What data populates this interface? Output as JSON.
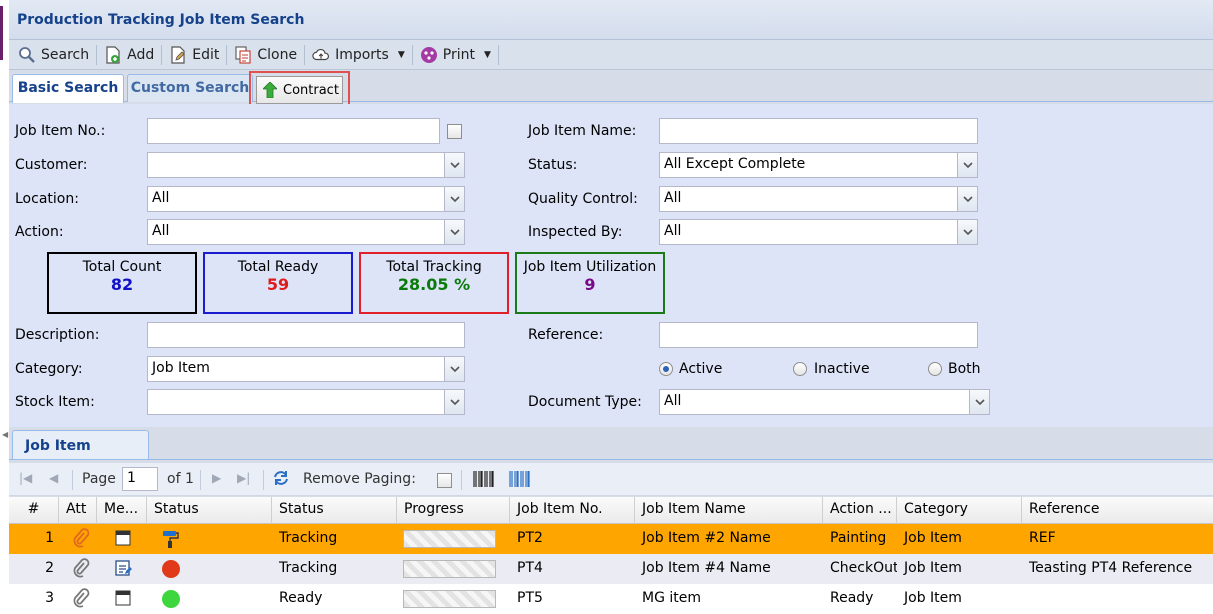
{
  "window": {
    "title": "Production Tracking Job Item Search"
  },
  "toolbar": {
    "search": "Search",
    "add": "Add",
    "edit": "Edit",
    "clone": "Clone",
    "imports": "Imports",
    "print": "Print"
  },
  "tabs": {
    "basic_search": "Basic Search",
    "custom_search": "Custom Search",
    "contract": "Contract"
  },
  "form": {
    "job_item_no_label": "Job Item No.:",
    "job_item_name_label": "Job Item Name:",
    "customer_label": "Customer:",
    "status_label": "Status:",
    "status_value": "All Except Complete",
    "location_label": "Location:",
    "location_value": "All",
    "quality_control_label": "Quality Control:",
    "quality_control_value": "All",
    "action_label": "Action:",
    "action_value": "All",
    "inspected_by_label": "Inspected By:",
    "inspected_by_value": "All",
    "description_label": "Description:",
    "reference_label": "Reference:",
    "category_label": "Category:",
    "category_value": "Job Item",
    "stock_item_label": "Stock Item:",
    "document_type_label": "Document Type:",
    "document_type_value": "All",
    "radio_active": "Active",
    "radio_inactive": "Inactive",
    "radio_both": "Both",
    "selected_radio": "Active"
  },
  "stats": {
    "total_count": {
      "label": "Total Count",
      "value": "82",
      "color": "#1010c8",
      "border": "#000000"
    },
    "total_ready": {
      "label": "Total Ready",
      "value": "59",
      "color": "#e01b1b",
      "border": "#1a1ad0"
    },
    "total_tracking": {
      "label": "Total Tracking",
      "value": "28.05 %",
      "color": "#0a7a0a",
      "border": "#e0202a"
    },
    "job_item_utilization": {
      "label": "Job Item Utilization",
      "value": "9",
      "color": "#7a0a8a",
      "border": "#1a7a1a"
    }
  },
  "grid": {
    "tab": "Job Item",
    "pager": {
      "page_label": "Page",
      "page_value": "1",
      "of_label": "of 1",
      "remove_paging_label": "Remove Paging:"
    },
    "columns": [
      "#",
      "Att",
      "Me...",
      "Status",
      "Status",
      "Progress",
      "Job Item No.",
      "Job Item Name",
      "Action ...",
      "Category",
      "Reference"
    ],
    "rows": [
      {
        "num": "1",
        "status_icon": "paint-roller-icon",
        "status": "Tracking",
        "progress": 0,
        "job_item_no": "PT2",
        "job_item_name": "Job Item #2 Name",
        "action": "Painting",
        "category": "Job Item",
        "reference": "REF",
        "selected": true
      },
      {
        "num": "2",
        "status_icon": "red-circle-icon",
        "status": "Tracking",
        "progress": 0,
        "job_item_no": "PT4",
        "job_item_name": "Job Item #4 Name",
        "action": "CheckOut",
        "category": "Job Item",
        "reference": "Teasting PT4 Reference",
        "selected": false
      },
      {
        "num": "3",
        "status_icon": "green-circle-icon",
        "status": "Ready",
        "progress": 0,
        "job_item_no": "PT5",
        "job_item_name": "MG item",
        "action": "Ready",
        "category": "Job Item",
        "reference": "",
        "selected": false
      }
    ]
  },
  "colors": {
    "selected_row": "#ffa500",
    "title_text": "#15428b",
    "highlight_box": "#e05050"
  }
}
